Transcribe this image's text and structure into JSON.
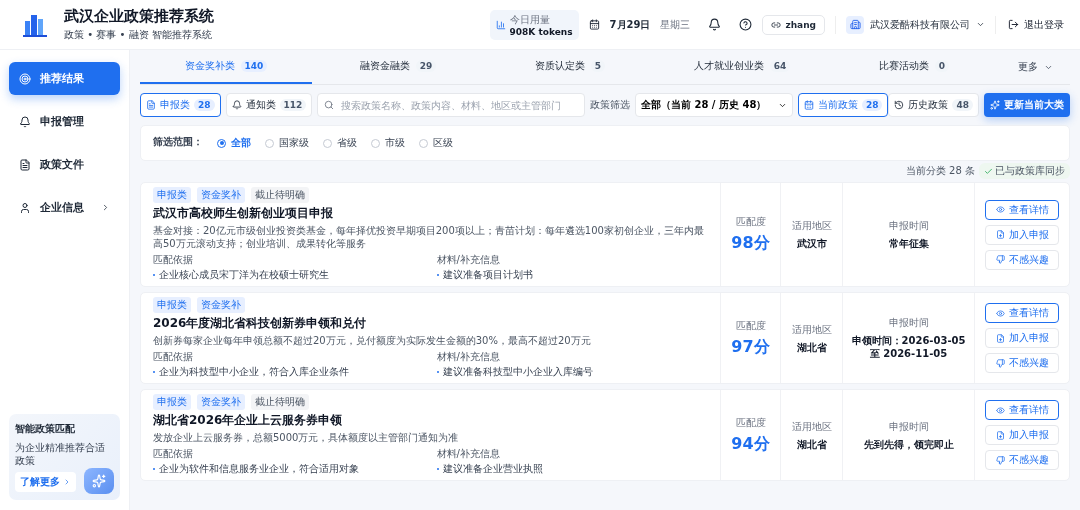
{
  "header": {
    "title": "武汉企业政策推荐系统",
    "subtitle": "政策 • 赛事 • 融资 智能推荐系统",
    "usage_label": "今日用量",
    "usage_value": "908K tokens",
    "date": "7月29日",
    "weekday": "星期三",
    "user": "zhang",
    "company": "武汉爱酷科技有限公司",
    "logout": "退出登录"
  },
  "sidebar": {
    "items": [
      {
        "label": "推荐结果",
        "selected": true,
        "kind": "link"
      },
      {
        "label": "申报管理",
        "selected": false,
        "kind": "link"
      },
      {
        "label": "政策文件",
        "selected": false,
        "kind": "link"
      },
      {
        "label": "企业信息",
        "selected": false,
        "kind": "group"
      }
    ],
    "promo": {
      "title": "智能政策匹配",
      "text": "为企业精准推荐合适政策",
      "link": "了解更多"
    }
  },
  "tabs": [
    {
      "label": "资金奖补类",
      "count": "140",
      "selected": true
    },
    {
      "label": "融资金融类",
      "count": "29",
      "selected": false
    },
    {
      "label": "资质认定类",
      "count": "5",
      "selected": false
    },
    {
      "label": "人才就业创业类",
      "count": "64",
      "selected": false
    },
    {
      "label": "比赛活动类",
      "count": "0",
      "selected": false
    }
  ],
  "more_tab": "更多",
  "toolbar": {
    "type_buttons": [
      {
        "label": "申报类",
        "count": "28",
        "selected": true
      },
      {
        "label": "通知类",
        "count": "112",
        "selected": false
      }
    ],
    "search_placeholder": "搜索政策名称、政策内容、材料、地区或主管部门",
    "filter_label": "政策筛选",
    "filter_value": "全部（当前 28 / 历史 48）",
    "period_buttons": [
      {
        "label": "当前政策",
        "count": "28",
        "selected": true
      },
      {
        "label": "历史政策",
        "count": "48",
        "selected": false
      }
    ],
    "refresh_button": "更新当前大类"
  },
  "scope": {
    "label": "筛选范围：",
    "options": [
      {
        "label": "全部",
        "selected": true
      },
      {
        "label": "国家级",
        "selected": false
      },
      {
        "label": "省级",
        "selected": false
      },
      {
        "label": "市级",
        "selected": false
      },
      {
        "label": "区级",
        "selected": false
      }
    ]
  },
  "summary": {
    "count": "当前分类 28 条",
    "sync": "已与政策库同步"
  },
  "policies": [
    {
      "tags": [
        {
          "label": "申报类",
          "kind": "category"
        },
        {
          "label": "资金奖补",
          "kind": "category"
        },
        {
          "label": "截止待明确",
          "kind": "status"
        }
      ],
      "title": "武汉市高校师生创新创业项目申报",
      "description": "基金对接：20亿元市级创业投资类基金，每年择优投资早期项目200项以上；青苗计划：每年遴选100家初创企业，三年内最高50万元滚动支持；创业培训、成果转化等服务",
      "basis_label": "匹配依据",
      "basis": [
        "企业核心成员宋丁洋为在校硕士研究生"
      ],
      "materials_label": "材料/补充信息",
      "materials": [
        "建议准备项目计划书"
      ],
      "match_label": "匹配度",
      "score": "98分",
      "region_label": "适用地区",
      "region": "武汉市",
      "time_label": "申报时间",
      "time": "常年征集",
      "actions": [
        "查看详情",
        "加入申报",
        "不感兴趣"
      ]
    },
    {
      "tags": [
        {
          "label": "申报类",
          "kind": "category"
        },
        {
          "label": "资金奖补",
          "kind": "category"
        }
      ],
      "title": "2026年度湖北省科技创新券申领和兑付",
      "description": "创新券每家企业每年申领总额不超过20万元，兑付额度为实际发生金额的30%，最高不超过20万元",
      "basis_label": "匹配依据",
      "basis": [
        "企业为科技型中小企业，符合入库企业条件"
      ],
      "materials_label": "材料/补充信息",
      "materials": [
        "建议准备科技型中小企业入库编号"
      ],
      "match_label": "匹配度",
      "score": "97分",
      "region_label": "适用地区",
      "region": "湖北省",
      "time_label": "申报时间",
      "time": "申领时间：2026-03-05 至 2026-11-05",
      "actions": [
        "查看详情",
        "加入申报",
        "不感兴趣"
      ]
    },
    {
      "tags": [
        {
          "label": "申报类",
          "kind": "category"
        },
        {
          "label": "资金奖补",
          "kind": "category"
        },
        {
          "label": "截止待明确",
          "kind": "status"
        }
      ],
      "title": "湖北省2026年企业上云服务券申领",
      "description": "发放企业上云服务券，总额5000万元，具体额度以主管部门通知为准",
      "basis_label": "匹配依据",
      "basis": [
        "企业为软件和信息服务业企业，符合适用对象"
      ],
      "materials_label": "材料/补充信息",
      "materials": [
        "建议准备企业营业执照"
      ],
      "match_label": "匹配度",
      "score": "94分",
      "region_label": "适用地区",
      "region": "湖北省",
      "time_label": "申报时间",
      "time": "先到先得，领完即止",
      "actions": [
        "查看详情",
        "加入申报",
        "不感兴趣"
      ]
    }
  ]
}
